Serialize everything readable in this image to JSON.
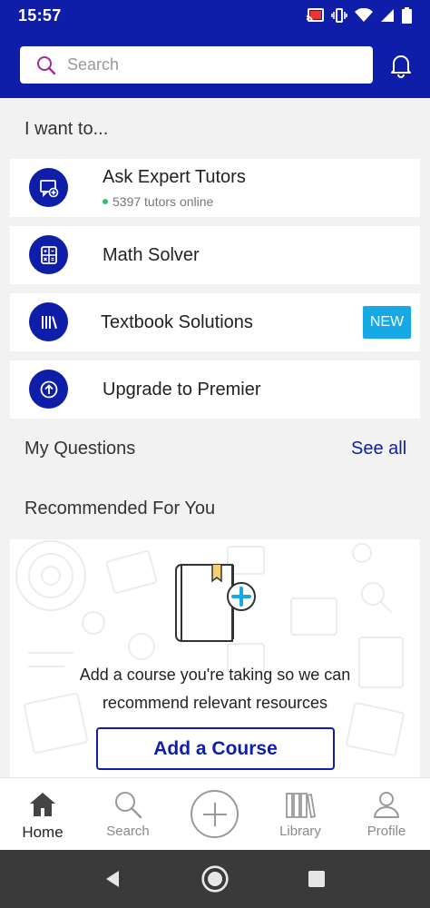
{
  "status_bar": {
    "time": "15:57"
  },
  "header": {
    "search_placeholder": "Search"
  },
  "i_want_to": {
    "title": "I want to...",
    "items": [
      {
        "label": "Ask Expert Tutors",
        "subtitle": "5397 tutors online",
        "icon": "chat-tutor-icon"
      },
      {
        "label": "Math Solver",
        "icon": "calculator-icon"
      },
      {
        "label": "Textbook Solutions",
        "icon": "books-icon",
        "badge": "NEW"
      },
      {
        "label": "Upgrade to Premier",
        "icon": "upgrade-arrow-icon"
      }
    ]
  },
  "my_questions": {
    "title": "My Questions",
    "see_all": "See all"
  },
  "recommended": {
    "title": "Recommended For You",
    "message_line1": "Add a course you're taking so we can",
    "message_line2": "recommend relevant resources",
    "button": "Add a Course"
  },
  "bottom_nav": {
    "items": [
      {
        "label": "Home",
        "icon": "home-icon",
        "active": true
      },
      {
        "label": "Search",
        "icon": "search-icon"
      },
      {
        "label": "",
        "icon": "add-plus-icon"
      },
      {
        "label": "Library",
        "icon": "library-icon"
      },
      {
        "label": "Profile",
        "icon": "profile-icon"
      }
    ]
  },
  "colors": {
    "brand": "#0e1ea8",
    "badge": "#17a9e6",
    "online_dot": "#2fbf71",
    "background": "#f2f2f2"
  }
}
